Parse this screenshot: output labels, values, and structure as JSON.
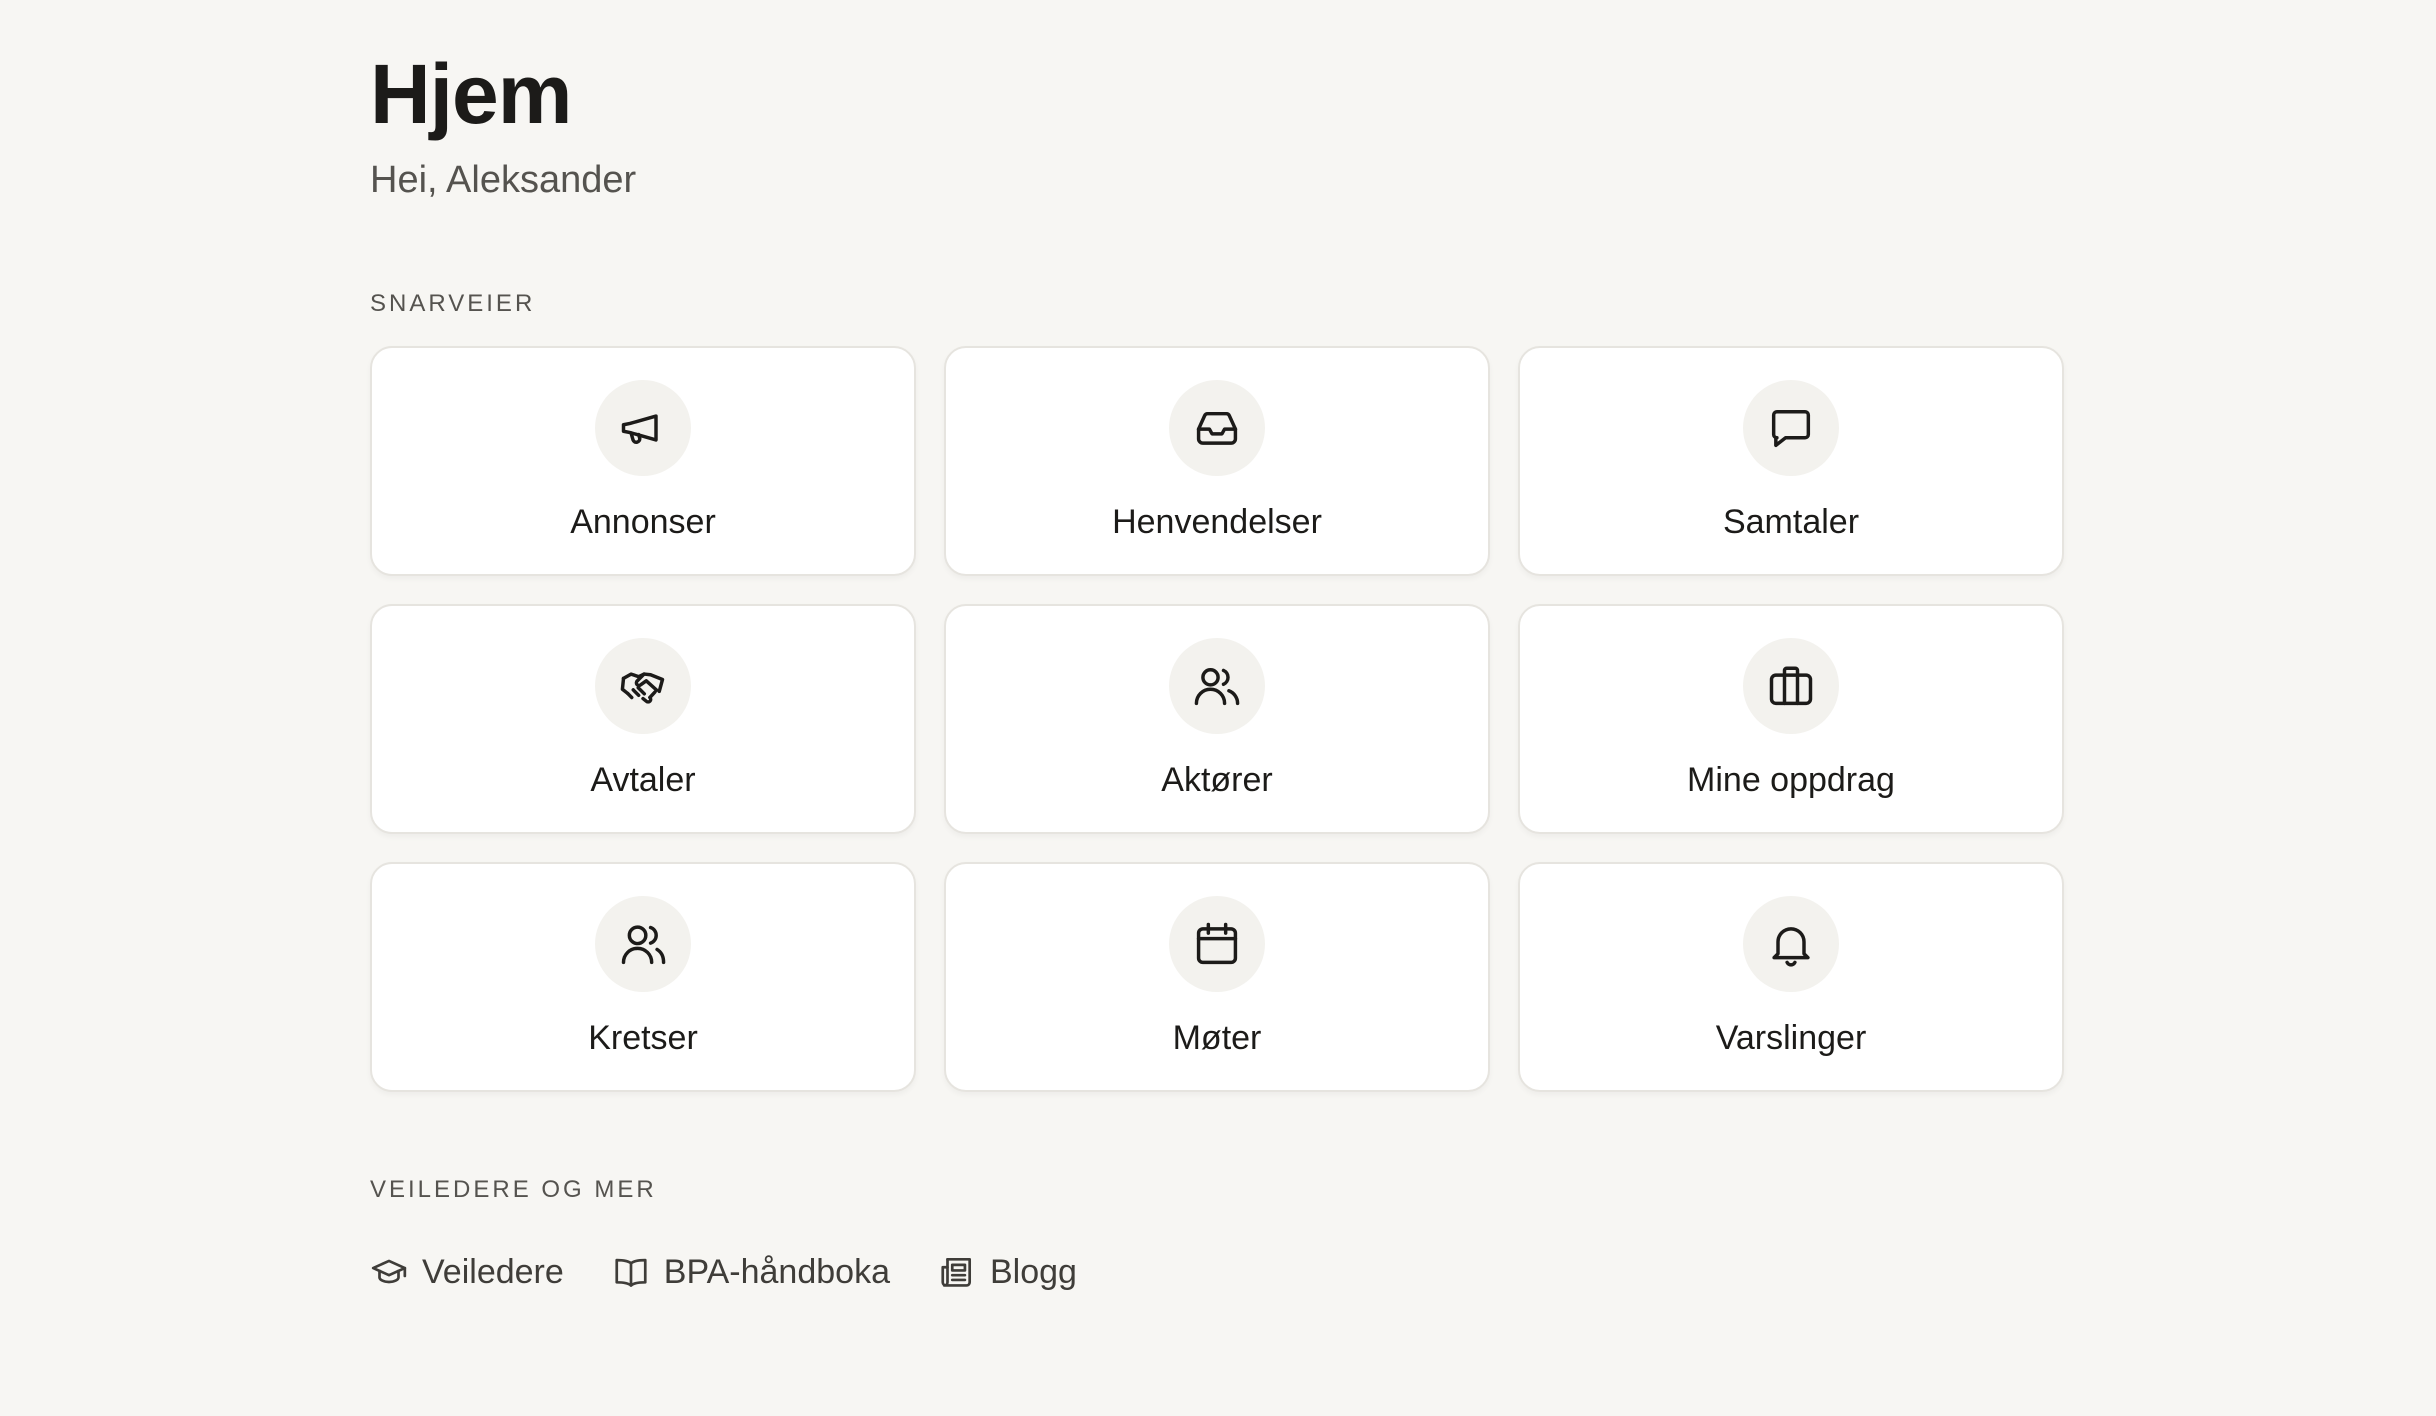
{
  "header": {
    "title": "Hjem",
    "greeting": "Hei, Aleksander"
  },
  "shortcuts": {
    "label": "SNARVEIER",
    "items": [
      {
        "label": "Annonser",
        "icon": "megaphone-icon"
      },
      {
        "label": "Henvendelser",
        "icon": "inbox-icon"
      },
      {
        "label": "Samtaler",
        "icon": "chat-bubble-icon"
      },
      {
        "label": "Avtaler",
        "icon": "handshake-icon"
      },
      {
        "label": "Aktører",
        "icon": "users-icon"
      },
      {
        "label": "Mine oppdrag",
        "icon": "briefcase-icon"
      },
      {
        "label": "Kretser",
        "icon": "group-icon"
      },
      {
        "label": "Møter",
        "icon": "calendar-icon"
      },
      {
        "label": "Varslinger",
        "icon": "bell-icon"
      }
    ]
  },
  "guides": {
    "label": "VEILEDERE OG MER",
    "links": [
      {
        "label": "Veiledere",
        "icon": "graduation-cap-icon"
      },
      {
        "label": "BPA-håndboka",
        "icon": "book-open-icon"
      },
      {
        "label": "Blogg",
        "icon": "newspaper-icon"
      }
    ]
  },
  "colors": {
    "background": "#f7f6f3",
    "card": "#ffffff",
    "card_border": "#e6e4df",
    "icon_circle": "#f3f2ee",
    "text": "#1c1b19",
    "muted_text": "#55534f"
  }
}
